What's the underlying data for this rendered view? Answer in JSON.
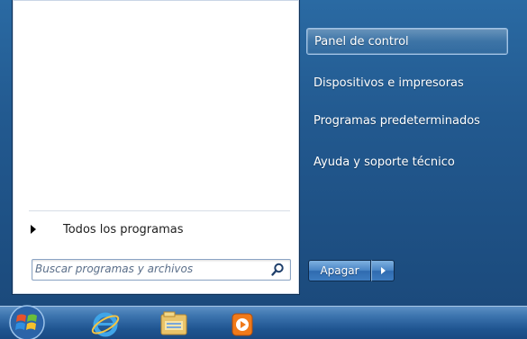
{
  "left_panel": {
    "all_programs_label": "Todos los programas",
    "search": {
      "placeholder": "Buscar programas y archivos"
    }
  },
  "right_panel": {
    "items": [
      {
        "label": "Panel de control",
        "highlighted": true
      },
      {
        "label": "Dispositivos e impresoras",
        "highlighted": false
      },
      {
        "label": "Programas predeterminados",
        "highlighted": false
      },
      {
        "label": "Ayuda y soporte técnico",
        "highlighted": false
      }
    ],
    "shutdown_label": "Apagar"
  },
  "taskbar": {
    "icons": [
      "start-orb-icon",
      "internet-explorer-icon",
      "windows-explorer-icon",
      "media-player-icon"
    ]
  },
  "colors": {
    "menu_glass": "#22598f",
    "left_panel_bg": "#ffffff",
    "taskbar": "#1f5490"
  }
}
